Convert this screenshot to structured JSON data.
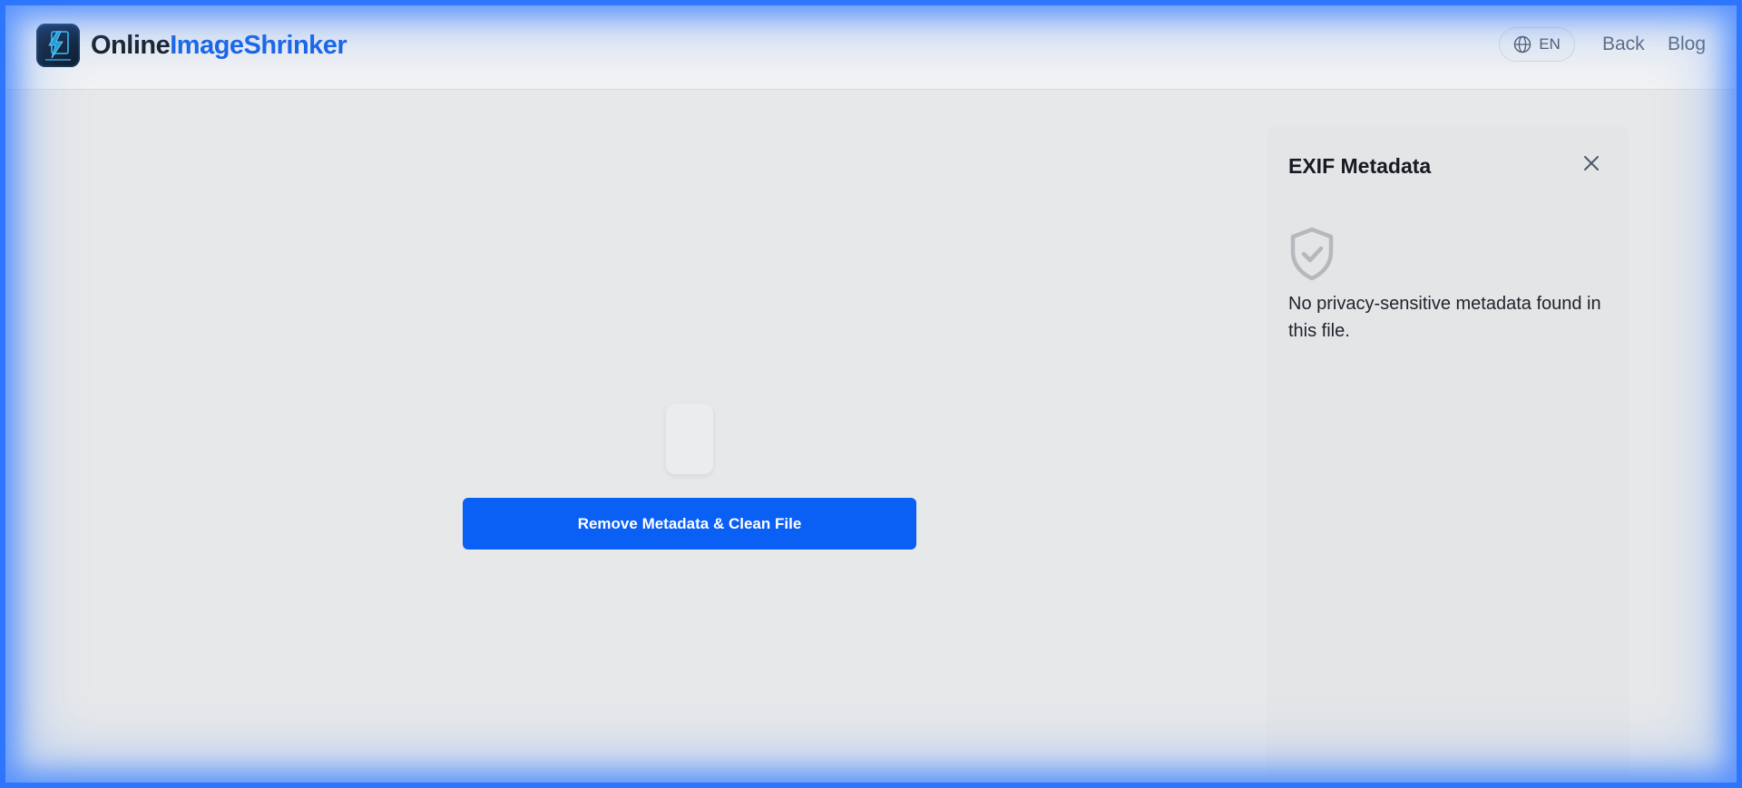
{
  "brand": {
    "name_part1": "Online",
    "name_part2": "ImageShrinker",
    "logo_icon": "lightning-document-icon"
  },
  "header": {
    "language": "EN",
    "language_icon": "globe-icon",
    "nav": {
      "back": "Back",
      "blog": "Blog"
    }
  },
  "main": {
    "action_button": "Remove Metadata & Clean File"
  },
  "panel": {
    "title": "EXIF Metadata",
    "close_icon": "close-icon",
    "status_icon": "shield-check-icon",
    "message": "No privacy-sensitive metadata found in this file."
  },
  "colors": {
    "accent": "#1763e6",
    "button": "#0a5ff5",
    "frame_glow": "#256eff"
  }
}
